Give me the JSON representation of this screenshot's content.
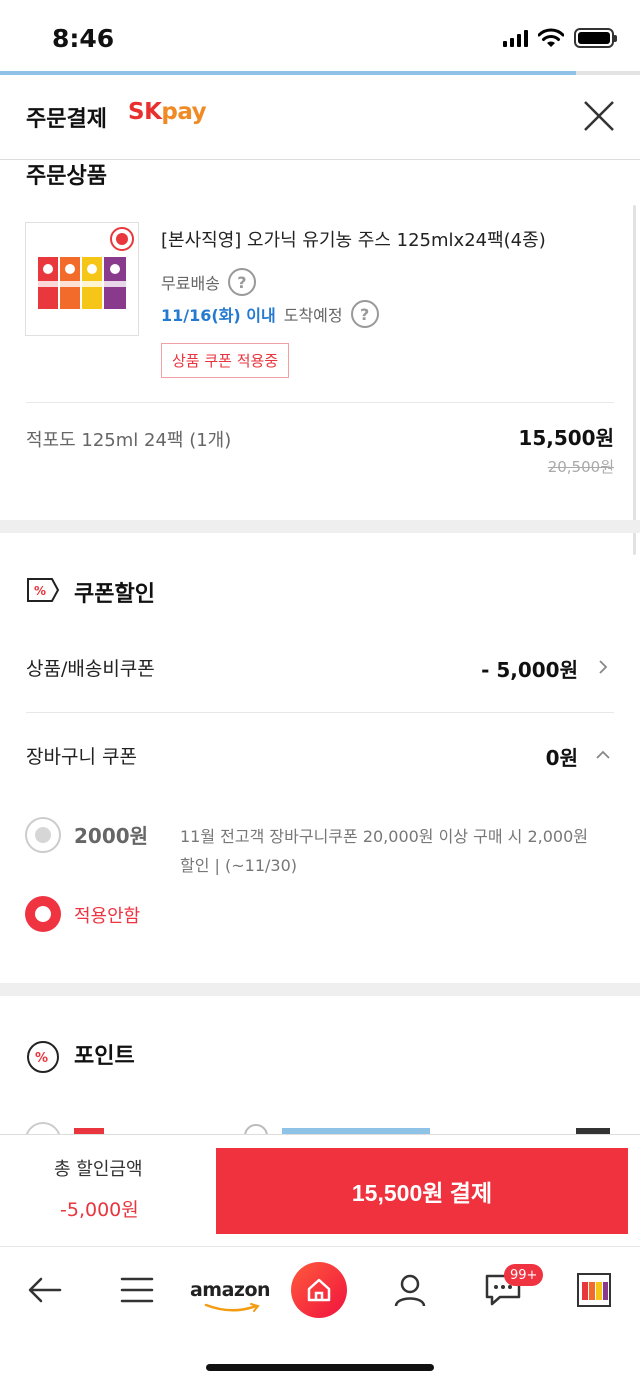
{
  "status_bar": {
    "time": "8:46"
  },
  "page": {
    "progress": 0.9
  },
  "header": {
    "title": "주문결제",
    "brand_sk": "SK",
    "brand_pay": "pay"
  },
  "product_section": {
    "title": "주문상품",
    "product_name": "[본사직영] 오가닉 유기농 주스 125mlx24팩(4종)",
    "shipping": "무료배송",
    "arrival_date": "11/16(화) 이내",
    "arrival_text": "도착예정",
    "coupon_tag": "상품 쿠폰 적용중",
    "option": "적포도 125ml 24팩 (1개)",
    "price": "15,500원",
    "original_price": "20,500원"
  },
  "coupon_section": {
    "title": "쿠폰할인",
    "product_coupon_label": "상품/배송비쿠폰",
    "product_coupon_value": "- 5,000원",
    "cart_coupon_label": "장바구니 쿠폰",
    "cart_coupon_value": "0원",
    "options": [
      {
        "amount": "2000원",
        "desc": "11월 전고객 장바구니쿠폰 20,000원 이상 구매 시 2,000원 할인 | (~11/30)",
        "selected": false
      },
      {
        "label": "적용안함",
        "selected": true
      }
    ]
  },
  "point_section": {
    "title": "포인트"
  },
  "pay_bar": {
    "total_label": "총 할인금액",
    "total_value": "-5,000원",
    "pay_button": "15,500원 결제"
  },
  "bottom_nav": {
    "amazon": "amazon",
    "badge": "99+"
  },
  "colors": {
    "accent": "#f0323e",
    "link_blue": "#2479d1",
    "brand_orange": "#f08a24"
  }
}
